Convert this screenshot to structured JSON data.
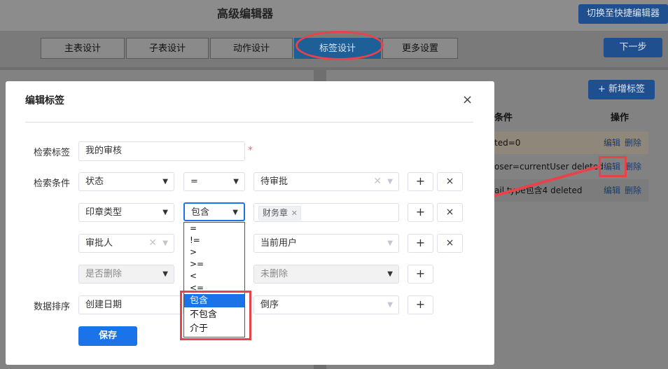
{
  "app": {
    "title": "高级编辑器",
    "switch_button": "切换至快捷编辑器",
    "next_button": "下一步",
    "add_tag_button": "新增标签",
    "steps": [
      "主表设计",
      "子表设计",
      "动作设计",
      "标签设计",
      "更多设置"
    ],
    "table": {
      "col_condition": "条件",
      "col_action": "操作",
      "rows": [
        {
          "condition": "ted=0",
          "edit": "编辑",
          "delete": "删除"
        },
        {
          "condition": "oser=currentUser deleted",
          "edit": "编辑",
          "delete": "删除"
        },
        {
          "condition": "=",
          "edit": "编辑",
          "delete": "删除"
        }
      ],
      "row3_text": "ail type包含4 deleted"
    }
  },
  "modal": {
    "title": "编辑标签",
    "close_icon": "close-icon",
    "label_name": "检索标签",
    "name_value": "我的审核",
    "required_mark": "*",
    "label_conditions": "检索条件",
    "conditions": [
      {
        "field": "状态",
        "operator": "=",
        "value": "待审批"
      },
      {
        "field": "印章类型",
        "operator": "包含",
        "value_tag": "财务章"
      },
      {
        "field": "审批人",
        "value": "当前用户"
      },
      {
        "field": "是否删除",
        "value": "未删除"
      }
    ],
    "label_sort": "数据排序",
    "sort_field": "创建日期",
    "sort_order": "倒序",
    "save_button": "保存",
    "plus": "+",
    "times": "×"
  },
  "dropdown": {
    "options": [
      "=",
      "!=",
      ">",
      ">=",
      "<",
      "<=",
      "包含",
      "不包含",
      "介于"
    ],
    "selected_index": 6
  },
  "colors": {
    "accent": "#1a73e8",
    "annotation": "#e8434a"
  }
}
